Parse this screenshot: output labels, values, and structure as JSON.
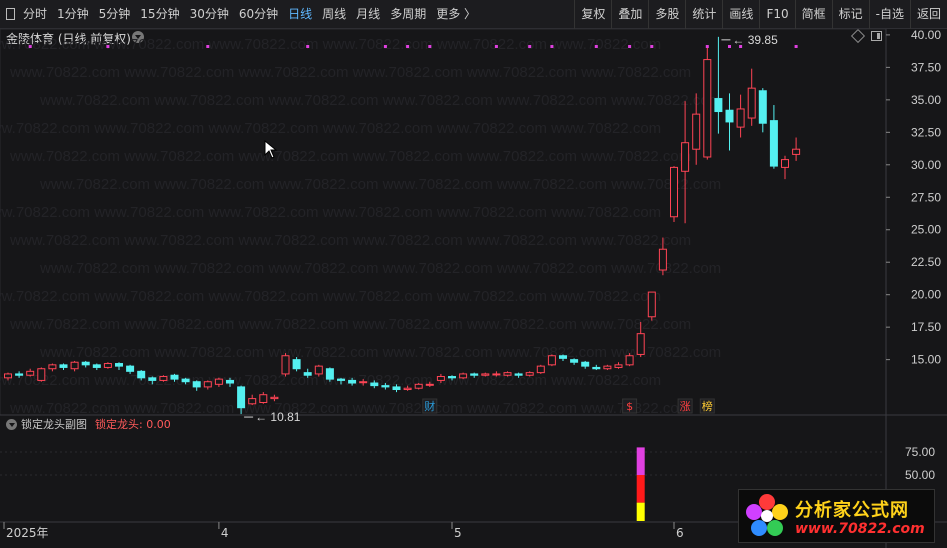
{
  "toolbar": {
    "periods": [
      {
        "label": "分时",
        "active": false
      },
      {
        "label": "1分钟",
        "active": false
      },
      {
        "label": "5分钟",
        "active": false
      },
      {
        "label": "15分钟",
        "active": false
      },
      {
        "label": "30分钟",
        "active": false
      },
      {
        "label": "60分钟",
        "active": false
      },
      {
        "label": "日线",
        "active": true
      },
      {
        "label": "周线",
        "active": false
      },
      {
        "label": "月线",
        "active": false
      },
      {
        "label": "多周期",
        "active": false
      },
      {
        "label": "更多 〉",
        "active": false
      }
    ],
    "right": [
      "复权",
      "叠加",
      "多股",
      "统计",
      "画线",
      "F10",
      "简框",
      "标记",
      "-自选",
      "返回"
    ]
  },
  "header": {
    "title": "金陵体育 (日线,前复权)"
  },
  "colors": {
    "up": "#ff4455",
    "down": "#54f0f0",
    "magenta": "#e040e0",
    "ma": "#ffffff",
    "grid": "#2a2a2e",
    "axis": "#cfcfcf"
  },
  "icons": [
    "dropdown-icon",
    "diamond-icon",
    "panel-toggle-icon",
    "mouse-cursor-icon"
  ],
  "chart_data": [
    {
      "type": "candlestick",
      "yaxis": {
        "ticks": [
          15.0,
          17.5,
          20.0,
          22.5,
          25.0,
          27.5,
          30.0,
          32.5,
          35.0,
          37.5,
          40.0
        ],
        "ylim": [
          11.2,
          40.3
        ]
      },
      "xaxis": {
        "labels": [
          {
            "text": "2025年",
            "index": 0
          },
          {
            "text": "4",
            "index": 19
          },
          {
            "text": "5",
            "index": 40
          },
          {
            "text": "6",
            "index": 60
          }
        ]
      },
      "candles": [
        [
          13.6,
          13.9,
          14.0,
          13.4
        ],
        [
          13.9,
          13.8,
          14.1,
          13.6
        ],
        [
          13.8,
          14.1,
          14.3,
          13.7
        ],
        [
          13.4,
          14.3,
          14.4,
          13.3
        ],
        [
          14.3,
          14.6,
          14.7,
          14.1
        ],
        [
          14.6,
          14.4,
          14.7,
          14.2
        ],
        [
          14.3,
          14.8,
          14.9,
          14.1
        ],
        [
          14.8,
          14.6,
          14.9,
          14.4
        ],
        [
          14.6,
          14.4,
          14.7,
          14.2
        ],
        [
          14.4,
          14.7,
          14.8,
          14.3
        ],
        [
          14.7,
          14.5,
          14.8,
          14.2
        ],
        [
          14.5,
          14.1,
          14.6,
          13.9
        ],
        [
          14.1,
          13.6,
          14.2,
          13.4
        ],
        [
          13.6,
          13.4,
          13.7,
          13.1
        ],
        [
          13.4,
          13.7,
          13.8,
          13.3
        ],
        [
          13.8,
          13.5,
          13.9,
          13.3
        ],
        [
          13.5,
          13.3,
          13.6,
          13.1
        ],
        [
          13.3,
          12.9,
          13.4,
          12.6
        ],
        [
          12.9,
          13.3,
          13.4,
          12.7
        ],
        [
          13.1,
          13.5,
          13.6,
          12.9
        ],
        [
          13.4,
          13.2,
          13.6,
          12.9
        ],
        [
          12.9,
          11.3,
          13.0,
          10.81
        ],
        [
          11.6,
          12.0,
          12.3,
          11.5
        ],
        [
          11.7,
          12.3,
          12.5,
          11.6
        ],
        [
          12.0,
          12.1,
          12.3,
          11.8
        ],
        [
          13.9,
          15.3,
          15.5,
          13.7
        ],
        [
          15.0,
          14.3,
          15.2,
          14.1
        ],
        [
          14.0,
          13.8,
          14.3,
          13.6
        ],
        [
          13.9,
          14.5,
          14.6,
          13.7
        ],
        [
          14.3,
          13.5,
          14.4,
          13.3
        ],
        [
          13.5,
          13.4,
          13.6,
          13.1
        ],
        [
          13.4,
          13.2,
          13.6,
          13.0
        ],
        [
          13.3,
          13.3,
          13.5,
          13.0
        ],
        [
          13.2,
          13.0,
          13.4,
          12.8
        ],
        [
          13.0,
          12.9,
          13.2,
          12.7
        ],
        [
          12.9,
          12.7,
          13.1,
          12.5
        ],
        [
          12.7,
          12.8,
          13.0,
          12.6
        ],
        [
          12.8,
          13.1,
          13.2,
          12.7
        ],
        [
          13.1,
          13.1,
          13.3,
          12.9
        ],
        [
          13.4,
          13.7,
          13.9,
          13.2
        ],
        [
          13.7,
          13.6,
          13.8,
          13.4
        ],
        [
          13.6,
          13.9,
          14.0,
          13.5
        ],
        [
          13.9,
          13.8,
          14.0,
          13.6
        ],
        [
          13.8,
          13.9,
          14.0,
          13.7
        ],
        [
          13.9,
          13.9,
          14.1,
          13.7
        ],
        [
          13.8,
          14.0,
          14.1,
          13.7
        ],
        [
          13.9,
          13.8,
          14.0,
          13.6
        ],
        [
          13.8,
          14.0,
          14.1,
          13.7
        ],
        [
          14.0,
          14.5,
          14.6,
          13.9
        ],
        [
          14.6,
          15.3,
          15.4,
          14.5
        ],
        [
          15.3,
          15.1,
          15.4,
          14.9
        ],
        [
          15.0,
          14.8,
          15.1,
          14.6
        ],
        [
          14.8,
          14.5,
          14.9,
          14.3
        ],
        [
          14.4,
          14.3,
          14.6,
          14.2
        ],
        [
          14.3,
          14.5,
          14.6,
          14.2
        ],
        [
          14.4,
          14.6,
          14.8,
          14.3
        ],
        [
          14.6,
          15.3,
          15.5,
          14.5
        ],
        [
          15.4,
          17.0,
          17.9,
          15.2
        ],
        [
          18.3,
          20.2,
          20.2,
          18.0
        ],
        [
          21.9,
          23.5,
          24.4,
          21.5
        ],
        [
          26.0,
          29.8,
          29.9,
          25.6
        ],
        [
          29.5,
          31.7,
          34.9,
          25.5
        ],
        [
          31.2,
          33.9,
          35.5,
          30.0
        ],
        [
          30.6,
          38.1,
          39.0,
          30.4
        ],
        [
          35.1,
          34.1,
          39.85,
          32.4
        ],
        [
          34.2,
          33.3,
          35.5,
          31.1
        ],
        [
          32.9,
          34.3,
          35.4,
          32.1
        ],
        [
          33.6,
          35.9,
          37.4,
          33.0
        ],
        [
          35.7,
          33.2,
          35.9,
          32.5
        ],
        [
          33.4,
          29.9,
          34.6,
          29.7
        ],
        [
          29.8,
          30.4,
          30.7,
          28.9
        ],
        [
          30.8,
          31.2,
          32.1,
          30.3
        ]
      ],
      "annotations": [
        {
          "text": "10.81",
          "index": 21,
          "value": 10.81
        },
        {
          "text": "39.85",
          "index": 64,
          "value": 39.85
        }
      ],
      "magenta_dots": [
        2,
        9,
        18,
        27,
        34,
        36,
        38,
        44,
        47,
        49,
        53,
        56,
        58,
        63,
        65,
        66,
        71
      ],
      "event_badges": [
        {
          "text": "财",
          "index": 38,
          "color": "#2a9bd8"
        },
        {
          "text": "$",
          "index": 56,
          "color": "#ff4040"
        },
        {
          "text": "涨",
          "index": 61,
          "color": "#ff4040"
        },
        {
          "text": "榜",
          "index": 63,
          "color": "#ffcc33"
        }
      ]
    },
    {
      "type": "bar",
      "title": "锁定龙头副图",
      "series_label": "锁定龙头:",
      "series_value": "0.00",
      "yaxis": {
        "ticks": [
          75.0,
          50.0
        ],
        "ylim": [
          0,
          100
        ]
      },
      "bars": [
        {
          "index": 57,
          "segments": [
            {
              "from": 0,
              "to": 20,
              "color": "#ffff00"
            },
            {
              "from": 20,
              "to": 50,
              "color": "#ff1a1a"
            },
            {
              "from": 50,
              "to": 80,
              "color": "#e040e0"
            }
          ]
        }
      ]
    }
  ],
  "watermark": "www.70822.com",
  "logo": {
    "title": "分析家公式网",
    "url": "www.70822.com"
  }
}
